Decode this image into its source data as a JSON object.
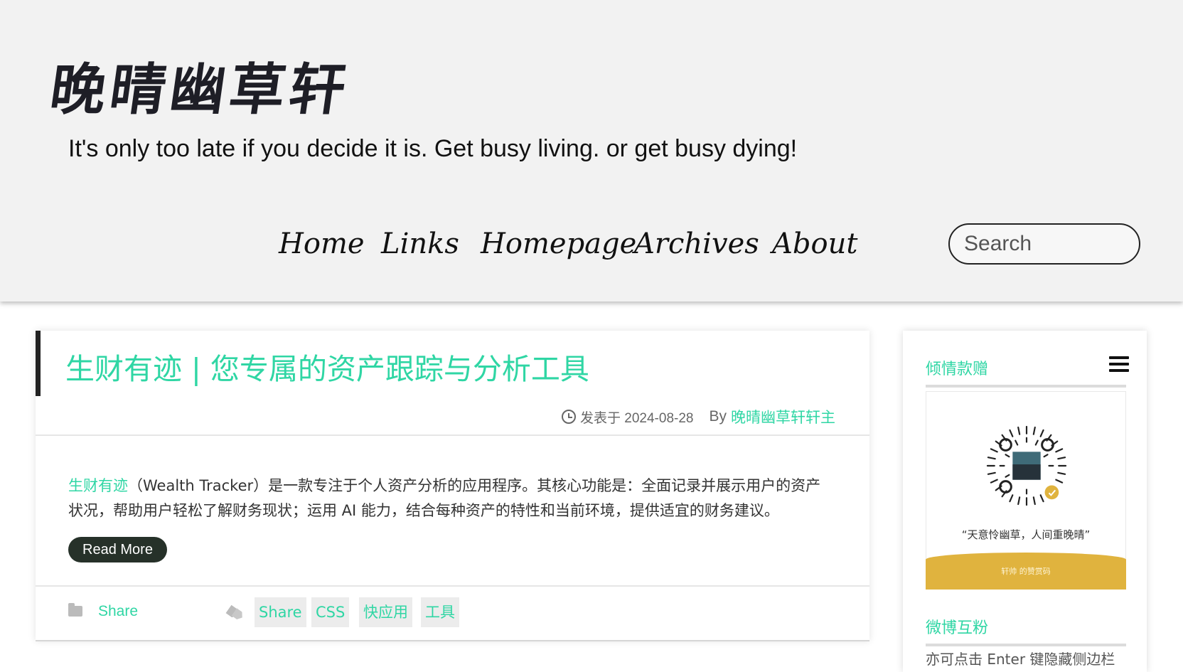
{
  "header": {
    "site_title": "晚晴幽草轩",
    "tagline": "It's only too late if you decide it is. Get busy living. or get busy dying!",
    "nav": [
      "Home",
      "Links",
      "Homepage",
      "Archives",
      "About"
    ],
    "search_placeholder": "Search"
  },
  "post": {
    "title": "生财有迹 | 您专属的资产跟踪与分析工具",
    "meta_prefix": "发表于 2024-08-28",
    "meta_by": "By",
    "author": "晚晴幽草轩轩主",
    "excerpt_link": "生财有迹",
    "excerpt_text": "（Wealth Tracker）是一款专注于个人资产分析的应用程序。其核心功能是：全面记录并展示用户的资产状况，帮助用户轻松了解财务现状；运用 AI 能力，结合每种资产的特性和当前环境，提供适宜的财务建议。",
    "read_more": "Read More",
    "category": "Share",
    "tags": [
      "Share",
      "CSS",
      "快应用",
      "工具"
    ]
  },
  "sidebar": {
    "donate_title": "倾情款赠",
    "quote": "“天意怜幽草，人间重晚晴”",
    "donate_banner": "轩帅 的赞赏码",
    "weibo_title": "微博互粉",
    "note": "亦可点击 Enter 键隐藏侧边栏"
  },
  "colors": {
    "accent": "#2fd6a4",
    "header_bg": "#f2f2f2",
    "read_more_bg": "#263129",
    "donate_banner": "#e0b33e"
  }
}
